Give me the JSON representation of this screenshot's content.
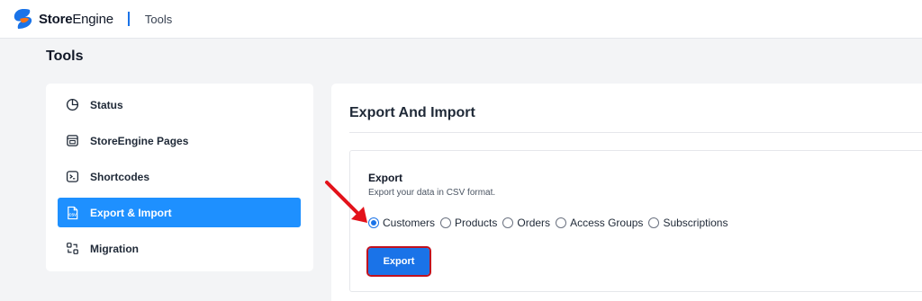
{
  "header": {
    "brand_bold": "Store",
    "brand_light": "Engine",
    "section": "Tools",
    "brand_color": "#1a73e8"
  },
  "page": {
    "title": "Tools"
  },
  "sidebar": {
    "items": [
      {
        "label": "Status",
        "icon": "pie-chart-icon",
        "active": false
      },
      {
        "label": "StoreEngine Pages",
        "icon": "pages-icon",
        "active": false
      },
      {
        "label": "Shortcodes",
        "icon": "terminal-icon",
        "active": false
      },
      {
        "label": "Export & Import",
        "icon": "csv-file-icon",
        "active": true
      },
      {
        "label": "Migration",
        "icon": "migration-icon",
        "active": false
      }
    ],
    "active_color": "#1e90ff"
  },
  "main": {
    "title": "Export And Import",
    "export": {
      "title": "Export",
      "description": "Export your data in CSV format.",
      "options": [
        "Customers",
        "Products",
        "Orders",
        "Access Groups",
        "Subscriptions"
      ],
      "selected": "Customers",
      "button_label": "Export"
    }
  },
  "annotation": {
    "arrow_color": "#e3121a",
    "highlight_color": "#c0111f"
  }
}
